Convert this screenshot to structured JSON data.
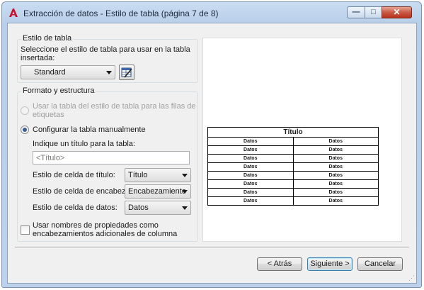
{
  "window": {
    "title": "Extracción de datos - Estilo de tabla (página 7 de 8)",
    "controls": {
      "minimize": "—",
      "maximize": "□",
      "close": "✕"
    }
  },
  "table_style": {
    "group_title": "Estilo de tabla",
    "description_line1": "Seleccione el estilo de tabla para usar en la tabla",
    "description_line2": "insertada:",
    "selected": "Standard",
    "edit_icon": "table-style-edit-icon"
  },
  "format": {
    "group_title": "Formato y estructura",
    "radio_use_style_line1": "Usar la tabla del estilo de tabla para las filas de",
    "radio_use_style_line2": "etiquetas",
    "radio_manual": "Configurar la tabla manualmente",
    "title_prompt": "Indique un título para la tabla:",
    "title_placeholder": "<Título>",
    "title_cell_label": "Estilo de celda de título:",
    "title_cell_value": "Título",
    "header_cell_label": "Estilo de celda de encabez.:",
    "header_cell_value": "Encabezamiento",
    "data_cell_label": "Estilo de celda de datos:",
    "data_cell_value": "Datos",
    "checkbox_line1": "Usar nombres de propiedades como",
    "checkbox_line2": "encabezamientos adicionales de columna"
  },
  "preview": {
    "title": "Título",
    "rows": [
      [
        "Datos",
        "Datos"
      ],
      [
        "Datos",
        "Datos"
      ],
      [
        "Datos",
        "Datos"
      ],
      [
        "Datos",
        "Datos"
      ],
      [
        "Datos",
        "Datos"
      ],
      [
        "Datos",
        "Datos"
      ],
      [
        "Datos",
        "Datos"
      ],
      [
        "Datos",
        "Datos"
      ]
    ]
  },
  "buttons": {
    "back": "< Atrás",
    "next": "Siguiente >",
    "cancel": "Cancelar"
  },
  "colors": {
    "accent": "#3a5f95",
    "close_button": "#c95a45"
  }
}
